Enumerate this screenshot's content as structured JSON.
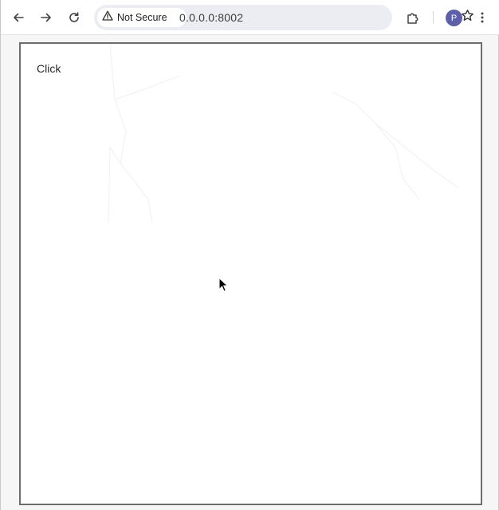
{
  "browser": {
    "security_label": "Not Secure",
    "url": "0.0.0.0:8002",
    "profile_initial": "P",
    "icons": {
      "back": "arrow-left-icon",
      "forward": "arrow-right-icon",
      "reload": "reload-icon",
      "warning": "warning-triangle-icon",
      "bookmark": "star-icon",
      "extensions": "puzzle-icon",
      "menu": "kebab-menu-icon"
    }
  },
  "page": {
    "click_label": "Click"
  }
}
